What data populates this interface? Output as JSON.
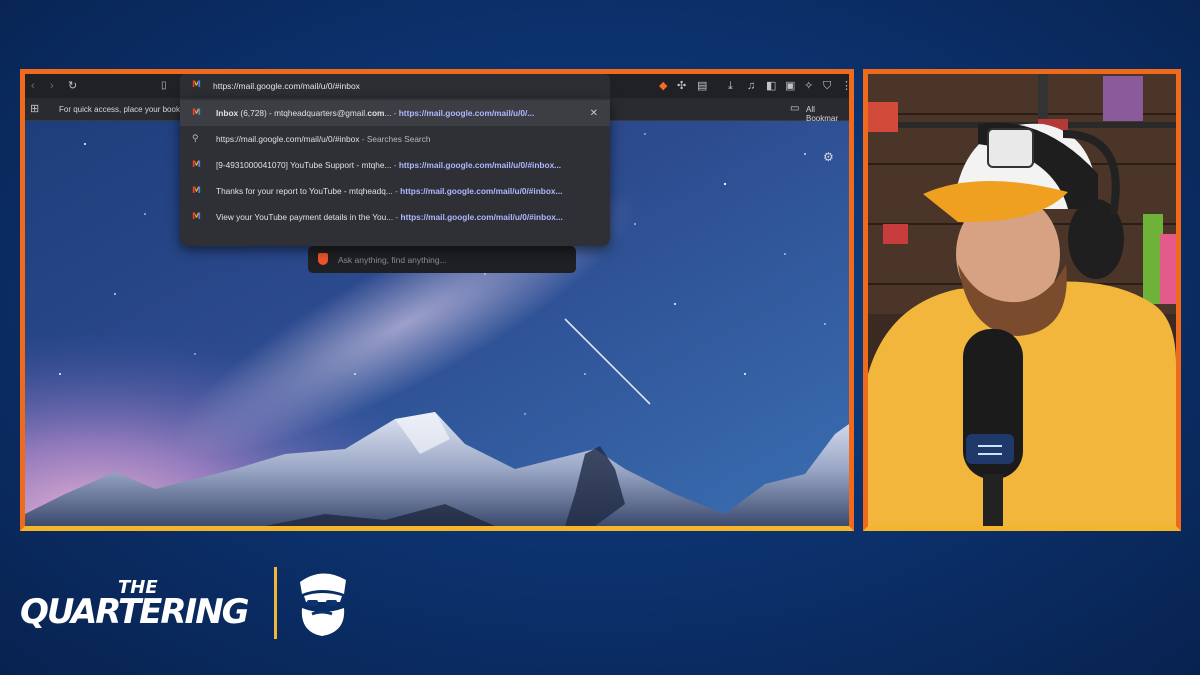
{
  "browser": {
    "address": "https://mail.google.com/mail/u/0/#inbox",
    "bookmarks_hint": "For quick access, place your bookm",
    "all_bookmarks": "All Bookmar"
  },
  "suggestions": [
    {
      "title_bold": "Inbox",
      "title": " (6,728) - mtqheadquarters@gmail.",
      "title_bold2": "com",
      "title_tail": "...",
      "sep": " - ",
      "url": "https://mail.google.com/mail/u/0/...",
      "icon": "gmail-icon"
    },
    {
      "title": "https://mail.google.com/mail/u/0/#inbox",
      "sep": " - ",
      "suffix": "Searches Search",
      "icon": "search-icon"
    },
    {
      "title": "[9-4931000041070] YouTube Support - mtqhe...",
      "sep": " - ",
      "url": "https://mail.google.com/mail/u/0/#inbox...",
      "icon": "gmail-icon"
    },
    {
      "title": "Thanks for your report to YouTube - mtqheadq...",
      "sep": " - ",
      "url": "https://mail.google.com/mail/u/0/#inbox...",
      "icon": "gmail-icon"
    },
    {
      "title": "View your YouTube payment details in the You...",
      "sep": " - ",
      "url": "https://mail.google.com/mail/u/0/#inbox...",
      "icon": "gmail-icon"
    }
  ],
  "search": {
    "placeholder": "Ask anything, find anything..."
  },
  "brand": {
    "line1": "THE",
    "line2": "QUARTERING"
  },
  "colors": {
    "frame_orange": "#f06a1c",
    "frame_yellow": "#f4b52a",
    "background": "#0c3370",
    "hoodie": "#f2b63c"
  }
}
